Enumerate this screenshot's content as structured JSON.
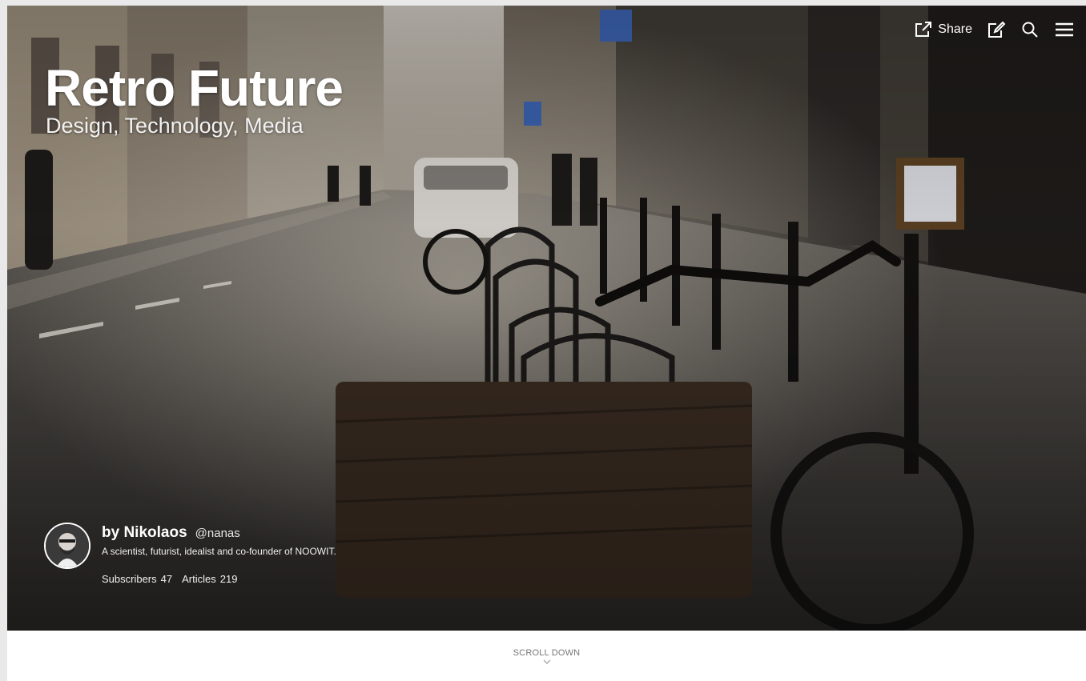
{
  "hero": {
    "title": "Retro Future",
    "subtitle": "Design, Technology, Media"
  },
  "topbar": {
    "share_label": "Share",
    "icons": [
      "share-icon",
      "edit-icon",
      "search-icon",
      "menu-icon"
    ]
  },
  "author": {
    "name": "by Nikolaos",
    "handle": "@nanas",
    "bio": "A scientist, futurist, idealist and co-founder of NOOWIT.",
    "stats": {
      "subscribers_label": "Subscribers",
      "subscribers_value": "47",
      "articles_label": "Articles",
      "articles_value": "219"
    }
  },
  "footer": {
    "scroll_label": "SCROLL DOWN"
  },
  "colors": {
    "background": "#e9e9e9",
    "text_on_image": "#ffffff",
    "muted": "#777777"
  }
}
